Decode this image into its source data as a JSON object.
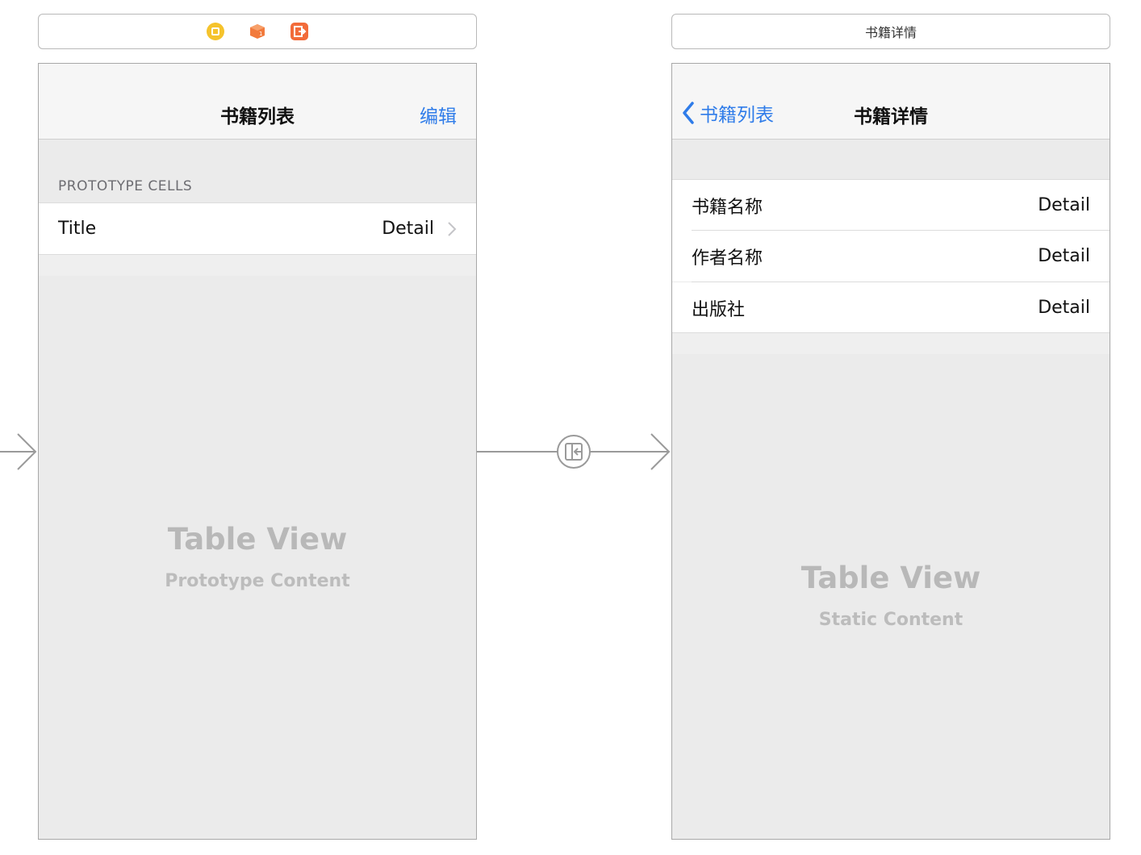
{
  "list_scene": {
    "toolbar_icons": [
      "view-controller-icon",
      "first-responder-icon",
      "exit-icon"
    ],
    "nav_title": "书籍列表",
    "nav_right_button": "编辑",
    "section_header": "PROTOTYPE CELLS",
    "cell": {
      "title": "Title",
      "detail": "Detail"
    },
    "placeholder_title": "Table View",
    "placeholder_subtitle": "Prototype Content"
  },
  "detail_scene": {
    "toolbar_title": "书籍详情",
    "nav_back_label": "书籍列表",
    "nav_title": "书籍详情",
    "cells": [
      {
        "title": "书籍名称",
        "detail": "Detail"
      },
      {
        "title": "作者名称",
        "detail": "Detail"
      },
      {
        "title": "出版社",
        "detail": "Detail"
      }
    ],
    "placeholder_title": "Table View",
    "placeholder_subtitle": "Static Content"
  },
  "colors": {
    "accent": "#2f7ce9",
    "scene_background": "#ebebeb",
    "segue_line": "#9a9a9a",
    "view_controller_icon": "#f5c32c",
    "exit_icon": "#f26b3a"
  }
}
